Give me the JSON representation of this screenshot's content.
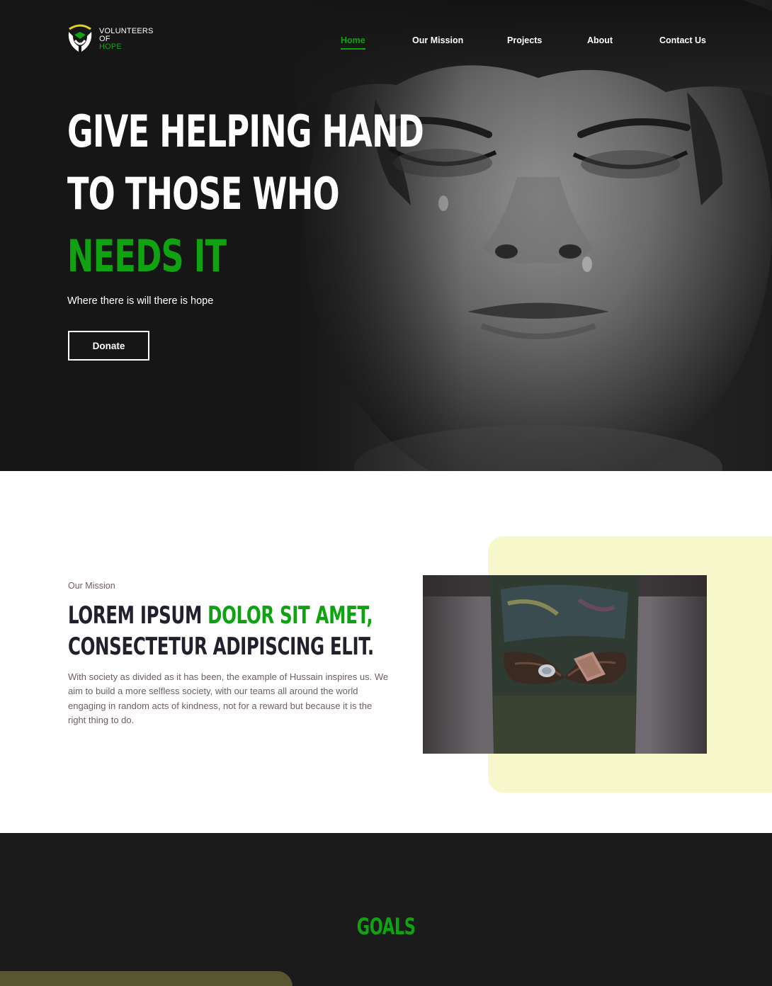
{
  "brand": {
    "line1": "VOLUNTEERS",
    "line2": "OF",
    "line3": "HOPE",
    "accent": "#0fa312",
    "logo_icon": "hands-shield-logo"
  },
  "nav": {
    "items": [
      {
        "label": "Home",
        "active": true
      },
      {
        "label": "Our Mission",
        "active": false
      },
      {
        "label": "Projects",
        "active": false
      },
      {
        "label": "About",
        "active": false
      },
      {
        "label": "Contact Us",
        "active": false
      }
    ]
  },
  "hero": {
    "line1": "GIVE HELPING HAND",
    "line2": "TO THOSE WHO",
    "line3": "NEEDS IT",
    "tagline": "Where there is will there is hope",
    "donate_label": "Donate",
    "image": "crying-child-photo"
  },
  "mission": {
    "label": "Our Mission",
    "title_part1": "LOREM IPSUM ",
    "title_part2": "DOLOR SIT AMET,",
    "title_line2": "CONSECTETUR ADIPISCING ELIT.",
    "body": "With society as divided as it has been, the example of Hussain inspires us. We aim to build a more selfless society, with our teams all around the world engaging in random acts of kindness, not for a reward but because it is the right thing to do.",
    "image": "child-hands-coins-photo",
    "panel_color": "#f6f8cb"
  },
  "goals": {
    "title": "GOALS",
    "card_color": "#585630"
  }
}
